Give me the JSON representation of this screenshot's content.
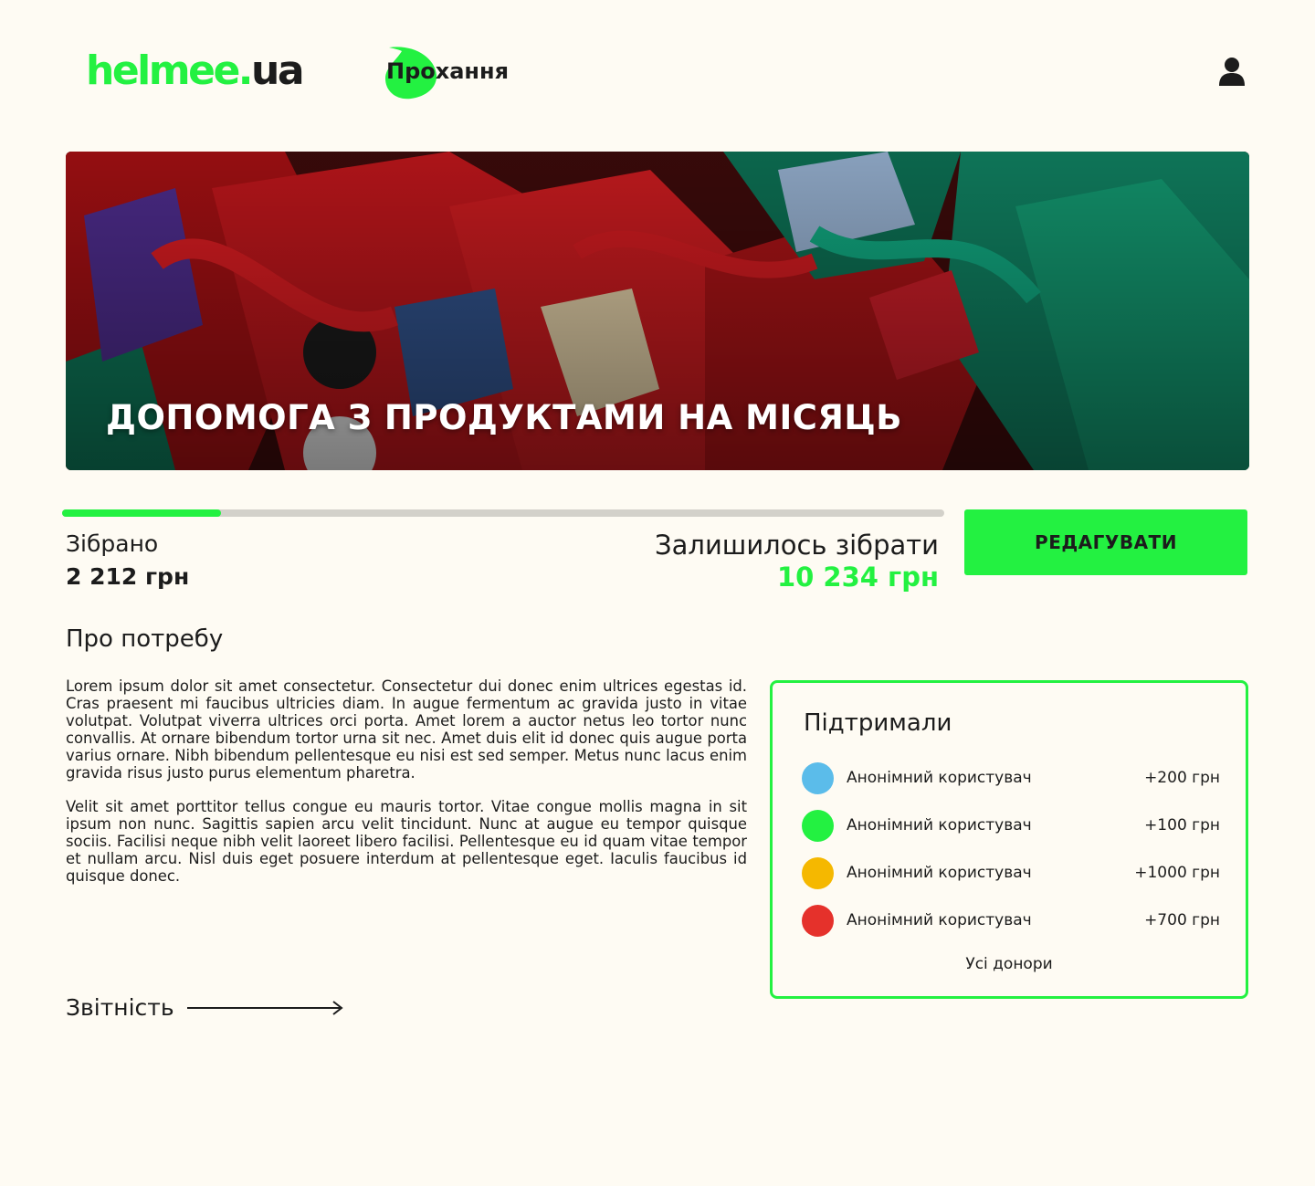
{
  "header": {
    "logo_main": "helmee.",
    "logo_tld": "ua",
    "nav_requests": "Прохання"
  },
  "hero": {
    "title": "ДОПОМОГА З ПРОДУКТАМИ НА МІСЯЦЬ"
  },
  "progress": {
    "fraction": 0.18
  },
  "funding": {
    "collected_label": "Зібрано",
    "collected_value": "2 212 грн",
    "remaining_label": "Залишилось зібрати",
    "remaining_value": "10 234 грн",
    "edit_label": "РЕДАГУВАТИ"
  },
  "about": {
    "title": "Про потребу",
    "paragraphs": [
      "Lorem ipsum dolor sit amet consectetur. Consectetur dui donec enim ultrices egestas id. Cras praesent mi faucibus ultricies diam. In augue fermentum ac gravida justo in vitae volutpat. Volutpat viverra ultrices orci porta. Amet lorem a auctor netus leo tortor nunc convallis. At ornare bibendum tortor urna sit nec. Amet duis elit id donec quis augue porta varius ornare. Nibh bibendum pellentesque eu nisi est sed semper. Metus nunc lacus enim gravida risus justo purus elementum pharetra.",
      "Velit sit amet porttitor tellus congue eu mauris tortor. Vitae congue mollis magna in sit ipsum non nunc. Sagittis sapien arcu velit tincidunt. Nunc at augue eu tempor quisque sociis. Facilisi neque nibh velit laoreet libero facilisi. Pellentesque eu id quam vitae tempor et nullam arcu. Nisl duis eget posuere interdum at pellentesque eget. Iaculis faucibus id quisque donec."
    ]
  },
  "reports": {
    "label": "Звітність"
  },
  "supporters": {
    "title": "Підтримали",
    "donors": [
      {
        "name": "Анонімний користувач",
        "amount": "+200 грн",
        "color": "#5bbcea"
      },
      {
        "name": "Анонімний користувач",
        "amount": "+100 грн",
        "color": "#23f141"
      },
      {
        "name": "Анонімний користувач",
        "amount": "+1000 грн",
        "color": "#f5b800"
      },
      {
        "name": "Анонімний користувач",
        "amount": "+700 грн",
        "color": "#e5312b"
      }
    ],
    "all_donors": "Усі донори"
  },
  "colors": {
    "accent": "#23f141",
    "background": "#fefbf3",
    "text": "#1c1c1c",
    "track": "#d3d1ca"
  }
}
